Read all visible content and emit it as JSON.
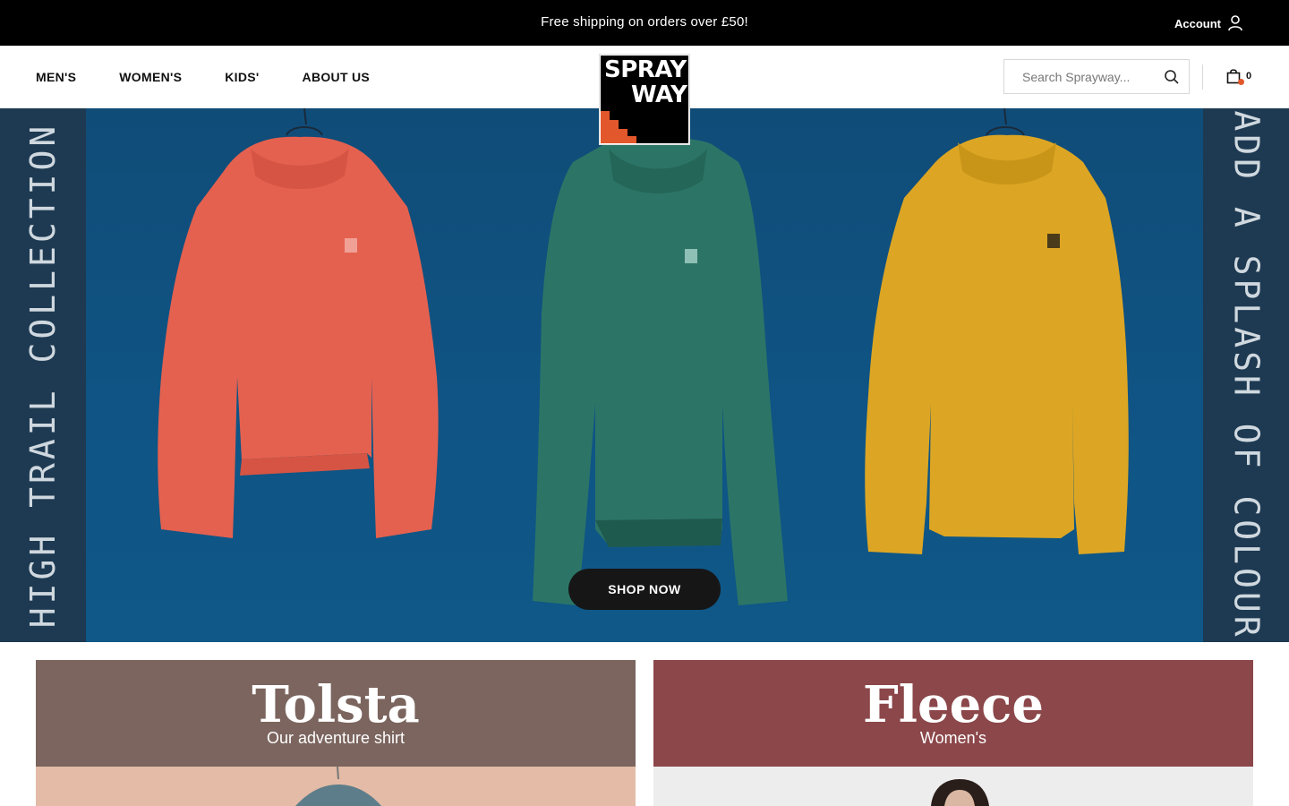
{
  "announcement": {
    "text": "Free shipping on orders over £50!"
  },
  "account": {
    "label": "Account",
    "icon": "user-icon"
  },
  "nav": {
    "items": [
      {
        "label": "MEN'S"
      },
      {
        "label": "WOMEN'S"
      },
      {
        "label": "KIDS'"
      },
      {
        "label": "ABOUT US"
      }
    ]
  },
  "logo": {
    "line1": "SPRAY",
    "line2": "WAY",
    "accent_color": "#e2572b"
  },
  "search": {
    "placeholder": "Search Sprayway...",
    "value": "",
    "icon": "search-icon"
  },
  "cart": {
    "count": "0",
    "icon": "shopping-bag-icon",
    "dot_color": "#e2572b"
  },
  "hero": {
    "left_text": "HIGH TRAIL COLLECTION",
    "right_text": "ADD A SPLASH OF COLOUR",
    "cta": "SHOP NOW",
    "background_color": "#0f5484",
    "shirt_colors": [
      "#e5614f",
      "#2c7566",
      "#dca624"
    ]
  },
  "promos": [
    {
      "title": "Tolsta",
      "subtitle": "Our adventure shirt",
      "color": "#7b655e"
    },
    {
      "title": "Fleece",
      "subtitle": "Women's",
      "color": "#8b474a"
    }
  ]
}
